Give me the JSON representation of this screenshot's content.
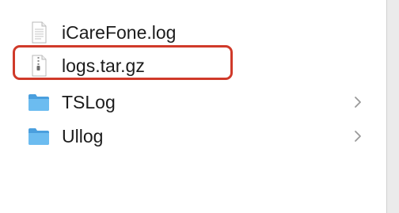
{
  "files": [
    {
      "name": "iCareFone.log",
      "kind": "document",
      "icon": "text-document-icon",
      "has_children": false
    },
    {
      "name": "logs.tar.gz",
      "kind": "archive",
      "icon": "archive-icon",
      "has_children": false,
      "highlighted": true
    },
    {
      "name": "TSLog",
      "kind": "folder",
      "icon": "folder-icon",
      "has_children": true
    },
    {
      "name": "Ullog",
      "kind": "folder",
      "icon": "folder-icon",
      "has_children": true
    }
  ],
  "colors": {
    "highlight": "#d03a2a",
    "folder": "#5aaee8",
    "chevron": "#9a9a9a"
  }
}
